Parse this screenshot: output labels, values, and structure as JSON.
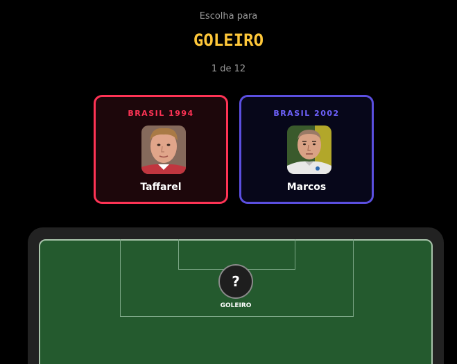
{
  "header": {
    "prompt": "Escolha para",
    "position": "GOLEIRO",
    "progress": "1 de 12"
  },
  "options": [
    {
      "team": "BRASIL 1994",
      "player": "Taffarel",
      "accent": "#ff3355",
      "photo_icon": "player-photo-taffarel"
    },
    {
      "team": "BRASIL 2002",
      "player": "Marcos",
      "accent": "#5b4fe0",
      "photo_icon": "player-photo-marcos"
    }
  ],
  "pitch": {
    "slot_symbol": "?",
    "slot_label": "GOLEIRO"
  },
  "colors": {
    "background": "#000000",
    "title": "#ffc83a",
    "pitch": "#245a2e"
  }
}
